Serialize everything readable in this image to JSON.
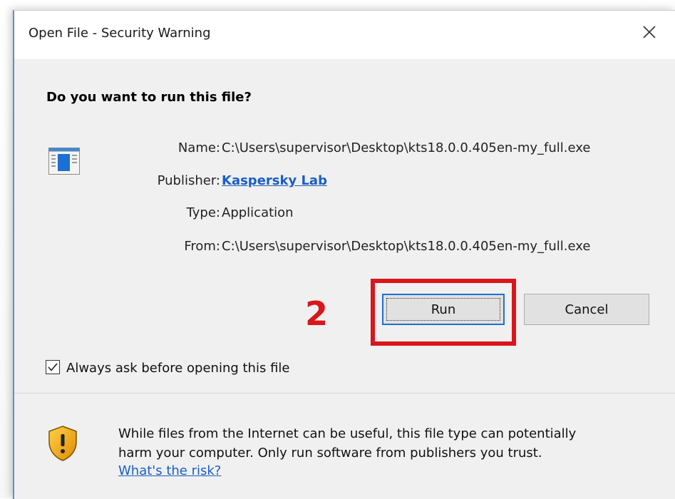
{
  "dialog": {
    "title": "Open File - Security Warning",
    "close_icon": "close-icon",
    "question": "Do you want to run this file?",
    "file_icon": "application-icon"
  },
  "details": {
    "name": {
      "label": "Name:",
      "value": "C:\\Users\\supervisor\\Desktop\\kts18.0.0.405en-my_full.exe"
    },
    "publisher": {
      "label": "Publisher:",
      "value": "Kaspersky Lab"
    },
    "type": {
      "label": "Type:",
      "value": "Application"
    },
    "from": {
      "label": "From:",
      "value": "C:\\Users\\supervisor\\Desktop\\kts18.0.0.405en-my_full.exe"
    }
  },
  "annotation": {
    "step_number": "2",
    "color": "#d9161c"
  },
  "buttons": {
    "run": "Run",
    "cancel": "Cancel"
  },
  "checkbox": {
    "label": "Always ask before opening this file",
    "checked": true
  },
  "warning": {
    "icon": "shield-warning-icon",
    "line1": "While files from the Internet can be useful, this file type can potentially",
    "line2": "harm your computer. Only run software from publishers you trust.",
    "link": "What's the risk?"
  },
  "colors": {
    "link": "#1a5ec4",
    "accent": "#1f6fd1",
    "annotation": "#d9161c"
  }
}
